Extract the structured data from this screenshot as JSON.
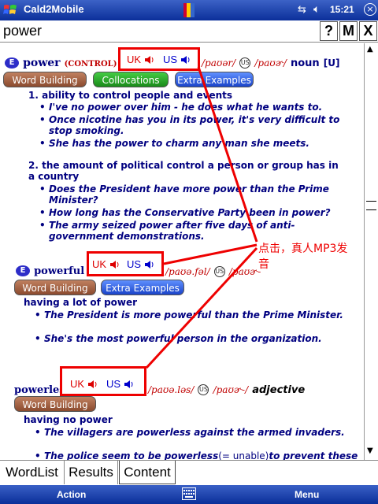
{
  "titlebar": {
    "app_title": "Cald2Mobile",
    "clock": "15:21",
    "close": "×"
  },
  "search": {
    "value": "power",
    "help_label": "?",
    "m_label": "M",
    "x_label": "X"
  },
  "entries": [
    {
      "badge": "E",
      "headword": "power",
      "extra": "(CONTROL)",
      "uk_label": "UK",
      "us_label": "US",
      "ipa_uk": "/paʊər/",
      "us_mark": "US",
      "ipa_us": "/paʊɚ/",
      "pos": "noun",
      "grammar": "[U]",
      "buttons": [
        "Word Building",
        "Collocations",
        "Extra Examples"
      ],
      "senses": [
        {
          "num": "1.",
          "definition": "ability to control people and events",
          "examples": [
            "I've no power over him - he does what he wants to.",
            "Once nicotine has you in its power, it's very difficult to stop smoking.",
            "She has the power to charm any man she meets."
          ]
        },
        {
          "num": "2.",
          "definition": "the amount of political control a person or group has in a country",
          "examples": [
            "Does the President have more power than the Prime Minister?",
            "How long has the Conservative Party been in power?",
            "The army seized power after five days of anti-government demonstrations."
          ]
        }
      ]
    },
    {
      "badge": "E",
      "headword": "powerful",
      "uk_label": "UK",
      "us_label": "US",
      "ipa_uk": "/paʊə.fəl/",
      "us_mark": "US",
      "ipa_us": "/paʊɚ-",
      "buttons": [
        "Word Building",
        "Extra Examples"
      ],
      "definition": "having a lot of power",
      "examples": [
        "The President is more powerful than the Prime Minister.",
        "She's the most powerful person in the organization."
      ]
    },
    {
      "headword": "powerless",
      "uk_label": "UK",
      "us_label": "US",
      "ipa_uk": "/paʊə.ləs/",
      "us_mark": "US",
      "ipa_us": "/paʊɚ-/",
      "pos": "adjective",
      "buttons": [
        "Word Building"
      ],
      "definition": "having no power",
      "examples": [
        "The villagers are powerless against the armed invaders.",
        "The police seem to be powerless",
        "(= unable)",
        "to prevent these"
      ]
    }
  ],
  "annotation": {
    "line1": "点击，真人MP3发",
    "line2": "音"
  },
  "tabs": [
    "WordList",
    "Results",
    "Content"
  ],
  "active_tab": "Content",
  "menubar": {
    "left": "Action",
    "right": "Menu"
  },
  "colors": {
    "annotation_red": "#e00000",
    "definition_navy": "#000080",
    "titlebar_blue": "#0b2f9a"
  }
}
